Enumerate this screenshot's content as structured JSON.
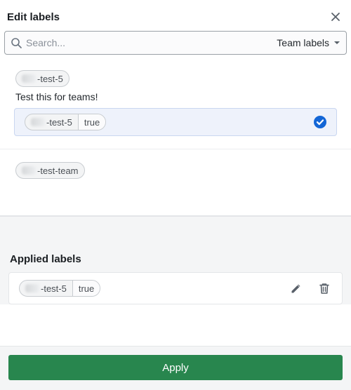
{
  "header": {
    "title": "Edit labels"
  },
  "search": {
    "placeholder": "Search...",
    "scope_label": "Team labels"
  },
  "sections": [
    {
      "chip": {
        "key_hidden_prefix": "…",
        "key_visible": "-test-5",
        "value": null
      },
      "description": "Test this for teams!",
      "option": {
        "key_visible": "-test-5",
        "value": "true",
        "selected": true
      }
    },
    {
      "chip": {
        "key_hidden_prefix": "…",
        "key_visible": "-test-team",
        "value": null
      }
    }
  ],
  "applied": {
    "title": "Applied labels",
    "items": [
      {
        "key_visible": "-test-5",
        "value": "true"
      }
    ]
  },
  "footer": {
    "apply_label": "Apply"
  }
}
